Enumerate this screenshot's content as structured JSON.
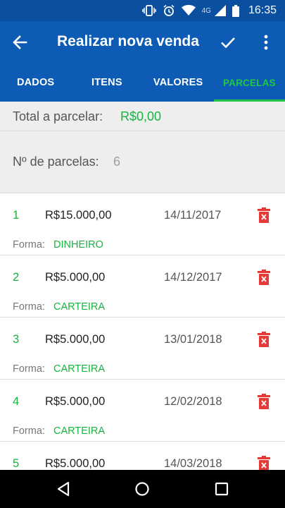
{
  "status_bar": {
    "network": "4G",
    "time": "16:35",
    "icons": [
      "vibrate-icon",
      "alarm-icon",
      "wifi-icon",
      "signal-icon",
      "battery-icon"
    ]
  },
  "toolbar": {
    "title": "Realizar nova venda",
    "back_icon": "arrow-back-icon",
    "confirm_icon": "check-icon",
    "menu_icon": "more-vert-icon"
  },
  "tabs": [
    {
      "label": "DADOS",
      "active": false
    },
    {
      "label": "ITENS",
      "active": false
    },
    {
      "label": "VALORES",
      "active": false
    },
    {
      "label": "PARCELAS",
      "active": true
    }
  ],
  "summary": {
    "total_label": "Total a parcelar:",
    "total_value": "R$0,00",
    "count_label": "Nº de parcelas:",
    "count_value": "6"
  },
  "installments": [
    {
      "number": "1",
      "amount": "R$15.000,00",
      "date": "14/11/2017",
      "form_label": "Forma:",
      "form_value": "DINHEIRO"
    },
    {
      "number": "2",
      "amount": "R$5.000,00",
      "date": "14/12/2017",
      "form_label": "Forma:",
      "form_value": "CARTEIRA"
    },
    {
      "number": "3",
      "amount": "R$5.000,00",
      "date": "13/01/2018",
      "form_label": "Forma:",
      "form_value": "CARTEIRA"
    },
    {
      "number": "4",
      "amount": "R$5.000,00",
      "date": "12/02/2018",
      "form_label": "Forma:",
      "form_value": "CARTEIRA"
    },
    {
      "number": "5",
      "amount": "R$5.000,00",
      "date": "14/03/2018",
      "form_label": "",
      "form_value": ""
    }
  ],
  "colors": {
    "primary": "#0e5bb5",
    "primary_dark": "#0b4fa0",
    "accent_green": "#17b53f",
    "delete_red": "#e53935"
  },
  "navigation_bar": {
    "icons": [
      "back-triangle-icon",
      "home-circle-icon",
      "recents-square-icon"
    ]
  }
}
